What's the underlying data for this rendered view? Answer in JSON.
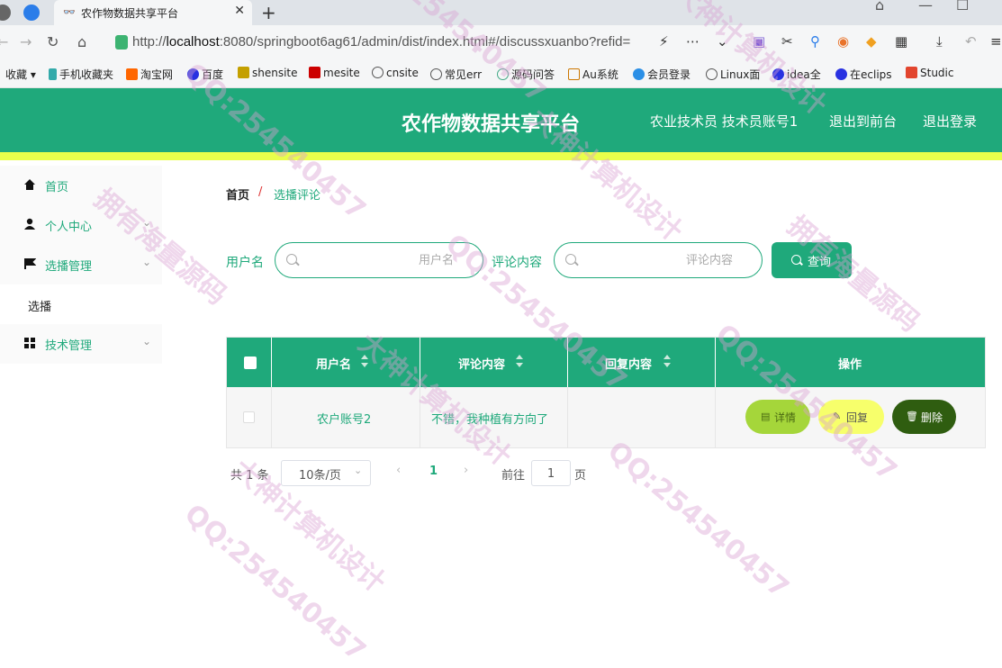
{
  "browser": {
    "tab_title": "农作物数据共享平台",
    "url_prefix": "http://",
    "url_host": "localhost",
    "url_rest": ":8080/springboot6ag61/admin/dist/index.html#/discussxuanbo?refid=",
    "bookmarks": [
      "收藏",
      "手机收藏夹",
      "淘宝网",
      "百度",
      "shensite",
      "mesite",
      "cnsite",
      "常见err",
      "源码问答",
      "Au系统",
      "会员登录",
      "Linux面",
      "idea全",
      "在eclips",
      "Studic"
    ]
  },
  "header": {
    "title": "农作物数据共享平台",
    "user": "农业技术员 技术员账号1",
    "to_front": "退出到前台",
    "logout": "退出登录"
  },
  "sidebar": {
    "items": [
      {
        "label": "首页"
      },
      {
        "label": "个人中心"
      },
      {
        "label": "选播管理"
      },
      {
        "label": "技术管理"
      }
    ],
    "sub_item": "选播"
  },
  "breadcrumb": {
    "home": "首页",
    "sep": "/",
    "current": "选播评论"
  },
  "search": {
    "username_label": "用户名",
    "username_placeholder": "用户名",
    "content_label": "评论内容",
    "content_placeholder": "评论内容",
    "query_button": "查询"
  },
  "table": {
    "columns": [
      "用户名",
      "评论内容",
      "回复内容",
      "操作"
    ],
    "rows": [
      {
        "username": "农户账号2",
        "content": "不错，我种植有方向了",
        "reply": ""
      }
    ],
    "actions": {
      "detail": "详情",
      "reply": "回复",
      "delete": "删除"
    }
  },
  "pagination": {
    "total": "共 1 条",
    "page_size": "10条/页",
    "current_page": "1",
    "goto_label": "前往",
    "goto_value": "1",
    "page_suffix": "页"
  },
  "colors": {
    "primary": "#1fa97b",
    "accent_bar": "#e9ff4b",
    "detail_btn": "#a5d63a",
    "reply_btn": "#f7ff6b",
    "delete_btn": "#2f5d10"
  },
  "watermarks": [
    "QQ:254540457",
    "大神计算机设计",
    "拥有海量源码"
  ]
}
